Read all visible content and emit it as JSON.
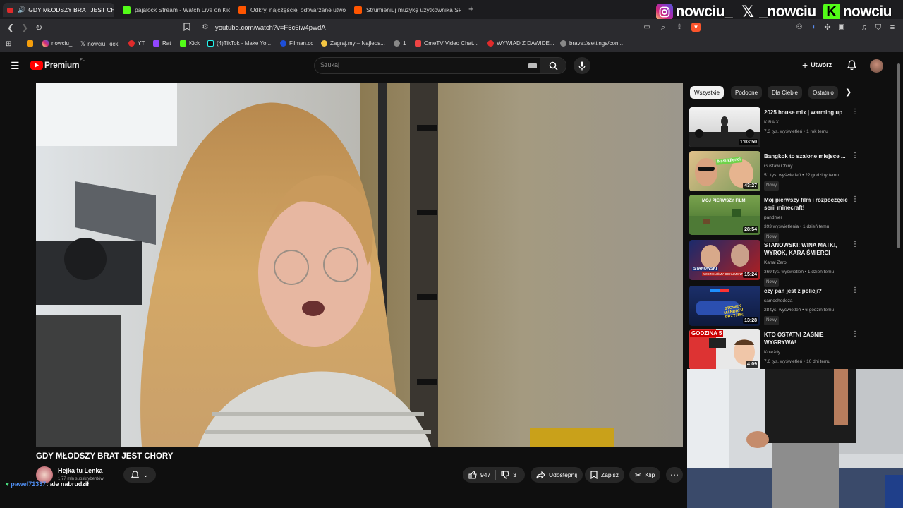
{
  "browser": {
    "tabs": [
      {
        "label": "GDY MŁODSZY BRAT JEST CH",
        "active": true,
        "favicon": "youtube-icon"
      },
      {
        "label": "pajalock Stream - Watch Live on Kick",
        "active": false,
        "favicon": "kick-icon"
      },
      {
        "label": "Odkryj najczęściej odtwarzane utwor",
        "active": false,
        "favicon": "soundcloud-icon"
      },
      {
        "label": "Strumieniuj muzykę użytkownika SFV",
        "active": false,
        "favicon": "soundcloud-icon"
      }
    ],
    "new_tab": "+",
    "url": "youtube.com/watch?v=F5c6iw4pwdA",
    "bookmarks": [
      {
        "label": "",
        "icon": "orange-folder-icon"
      },
      {
        "label": "nowciu_",
        "icon": "instagram-icon"
      },
      {
        "label": "nowciu_kick",
        "icon": "x-icon"
      },
      {
        "label": "YT",
        "icon": "youtube-icon"
      },
      {
        "label": "Rat",
        "icon": "twitch-icon"
      },
      {
        "label": "Kick",
        "icon": "kick-icon"
      },
      {
        "label": "(4)TikTok - Make Yo...",
        "icon": "tiktok-icon"
      },
      {
        "label": "Filman.cc",
        "icon": "filman-icon"
      },
      {
        "label": "Zagraj.my – Najleps...",
        "icon": "person-icon"
      },
      {
        "label": "1",
        "icon": "globe-icon"
      },
      {
        "label": "OmeTV Video Chat...",
        "icon": "ometv-icon"
      },
      {
        "label": "WYWIAD Z DAWIDE...",
        "icon": "youtube-icon"
      },
      {
        "label": "brave://settings/con...",
        "icon": "globe-icon"
      }
    ]
  },
  "overlay": {
    "socials": [
      {
        "icon": "instagram-icon",
        "handle": "nowciu_"
      },
      {
        "icon": "x-icon",
        "handle": "_nowciu"
      },
      {
        "icon": "kick-icon",
        "handle": "nowciu"
      }
    ],
    "chat": {
      "user": "pawel71337",
      "message": ": ale nabrudził"
    }
  },
  "youtube": {
    "logo_text": "Premium",
    "logo_region": "PL",
    "search_placeholder": "Szukaj",
    "create_label": "Utwórz",
    "video": {
      "title": "GDY MŁODSZY BRAT JEST CHORY",
      "channel": "Hejka tu Lenka",
      "subscribers": "1,77 mln subskrybentów",
      "likes": "947",
      "dislikes": "3",
      "share": "Udostępnij",
      "save": "Zapisz",
      "clip": "Klip"
    },
    "chips": [
      "Wszystkie",
      "Podobne",
      "Dla Ciebie",
      "Ostatnio"
    ],
    "recommendations": [
      {
        "title": "2025 house mix | warming up",
        "channel": "KIRA X",
        "meta": "7,3 tys. wyświetleń • 1 rok temu",
        "duration": "1:03:50",
        "badge": ""
      },
      {
        "title": "Bangkok to szalone miejsce ...",
        "channel": "Gustaw Chiny",
        "meta": "51 tys. wyświetleń • 22 godziny temu",
        "duration": "43:27",
        "badge": "Nowy"
      },
      {
        "title": "Mój pierwszy film i rozpoczęcie serii minecraft!",
        "channel": "pandmer",
        "meta": "393 wyświetlenia • 1 dzień temu",
        "duration": "28:54",
        "badge": "Nowy"
      },
      {
        "title": "STANOWSKI: WINA MATKI, WYROK, KARA ŚMIERCI",
        "channel": "Kanał Zero",
        "meta": "369 tys. wyświetleń • 1 dzień temu",
        "duration": "15:24",
        "badge": "Nowy"
      },
      {
        "title": "czy pan jest z policji?",
        "channel": "samochodoza",
        "meta": "28 tys. wyświetleń • 6 godzin temu",
        "duration": "13:28",
        "badge": "Nowy"
      },
      {
        "title": "KTO OSTATNI ZAŚNIE WYGRYWA!",
        "channel": "Koleżdy",
        "meta": "7,6 tys. wyświetleń • 10 dni temu",
        "duration": "4:09",
        "badge": ""
      }
    ],
    "thumb_texts": {
      "r2": "Nasi klienci",
      "r3": "MÓJ PIERWSZY FILM!",
      "r4a": "STANOWSKI",
      "r4b": "WIDZIELIŚMY DOKUMENT",
      "r5": "STOWEK MANDATU PRZYJMĘ",
      "r6": "GODZINA 5"
    }
  }
}
